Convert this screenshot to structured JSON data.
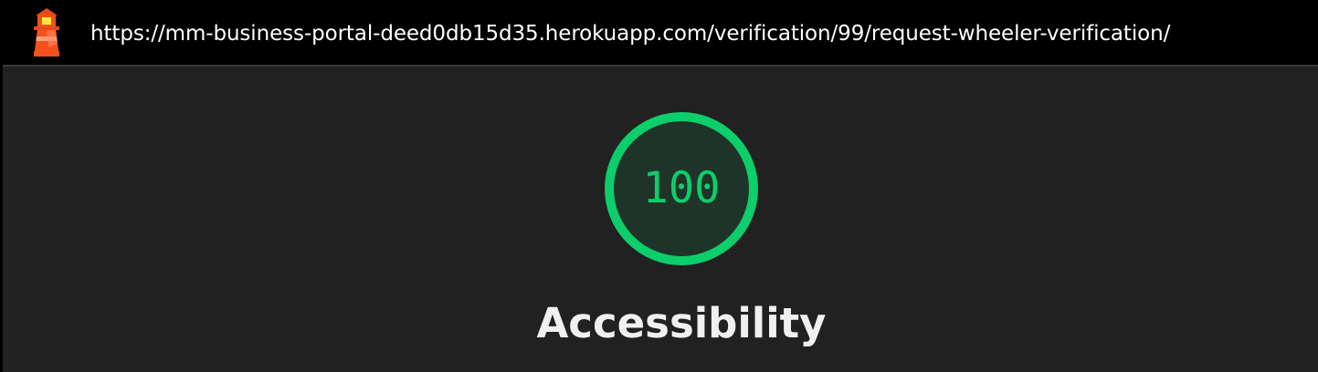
{
  "header": {
    "url": "https://mm-business-portal-deed0db15d35.herokuapp.com/verification/99/request-wheeler-verification/",
    "icon": "lighthouse-icon"
  },
  "score": {
    "value": "100",
    "fraction": 1.0,
    "color": "#0cce6b",
    "track_color": "#0cce6b",
    "fill_color": "#1f3429"
  },
  "category": {
    "title": "Accessibility"
  }
}
